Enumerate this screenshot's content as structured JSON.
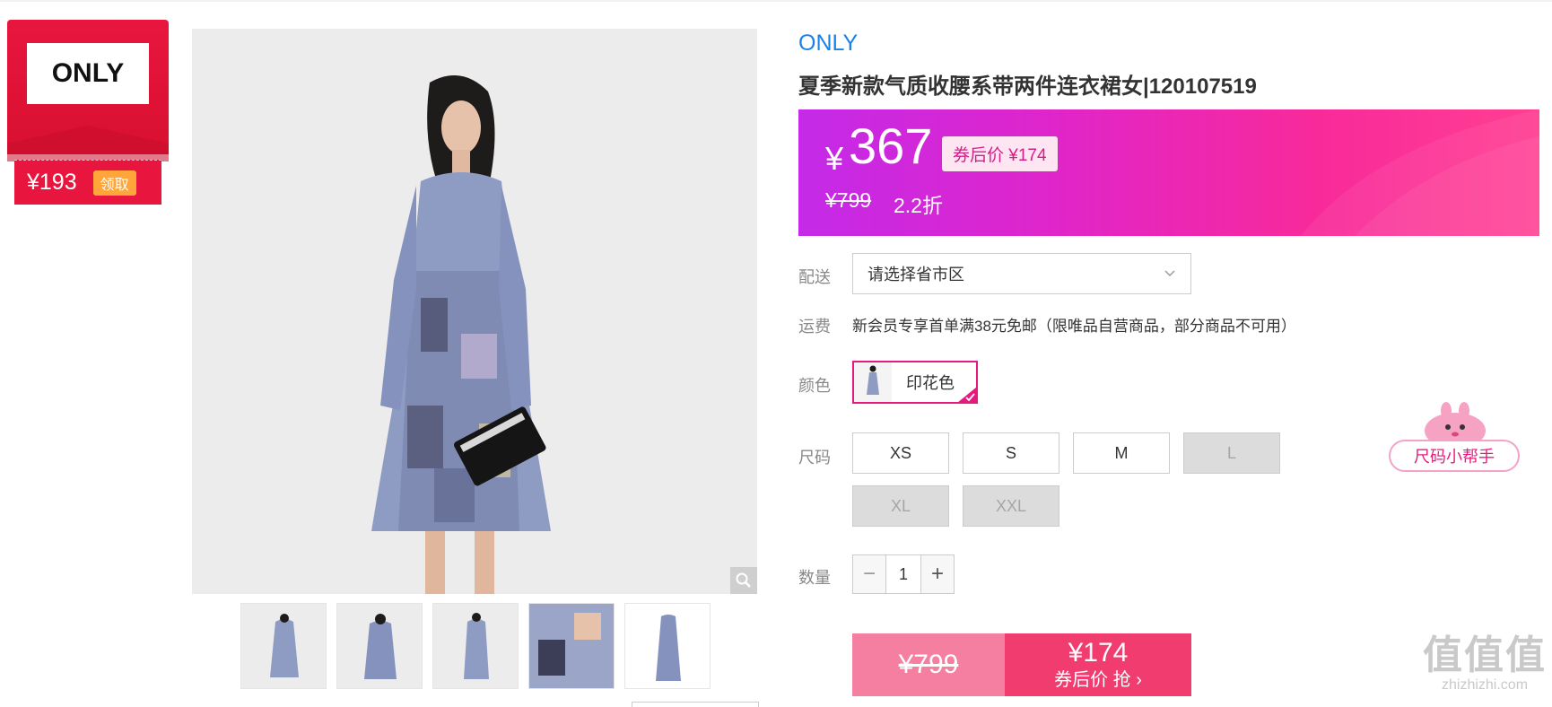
{
  "brand_badge": {
    "logo_text": "ONLY",
    "coupon_amount": "¥193",
    "coupon_action": "领取",
    "accent": "#e8163f"
  },
  "product": {
    "brand": "ONLY",
    "title": "夏季新款气质收腰系带两件连衣裙女|120107519"
  },
  "price": {
    "yen": "¥",
    "current": "367",
    "after_coupon": "券后价 ¥174",
    "original": "¥799",
    "discount": "2.2折"
  },
  "delivery": {
    "label": "配送",
    "placeholder": "请选择省市区"
  },
  "shipping": {
    "label": "运费",
    "text": "新会员专享首单满38元免邮（限唯品自营商品，部分商品不可用）"
  },
  "color": {
    "label": "颜色",
    "selected": "印花色"
  },
  "sizes": {
    "label": "尺码",
    "options": [
      {
        "name": "XS",
        "available": true
      },
      {
        "name": "S",
        "available": true
      },
      {
        "name": "M",
        "available": true
      },
      {
        "name": "L",
        "available": false
      },
      {
        "name": "XL",
        "available": false
      },
      {
        "name": "XXL",
        "available": false
      }
    ],
    "helper": "尺码小帮手"
  },
  "quantity": {
    "label": "数量",
    "value": "1",
    "minus": "−",
    "plus": "+"
  },
  "buy": {
    "original": "¥799",
    "price": "¥174",
    "action": "券后价 抢"
  },
  "watermark": {
    "big": "值值值",
    "small": "zhizhizhi.com"
  },
  "thumbnails_count_text": ""
}
